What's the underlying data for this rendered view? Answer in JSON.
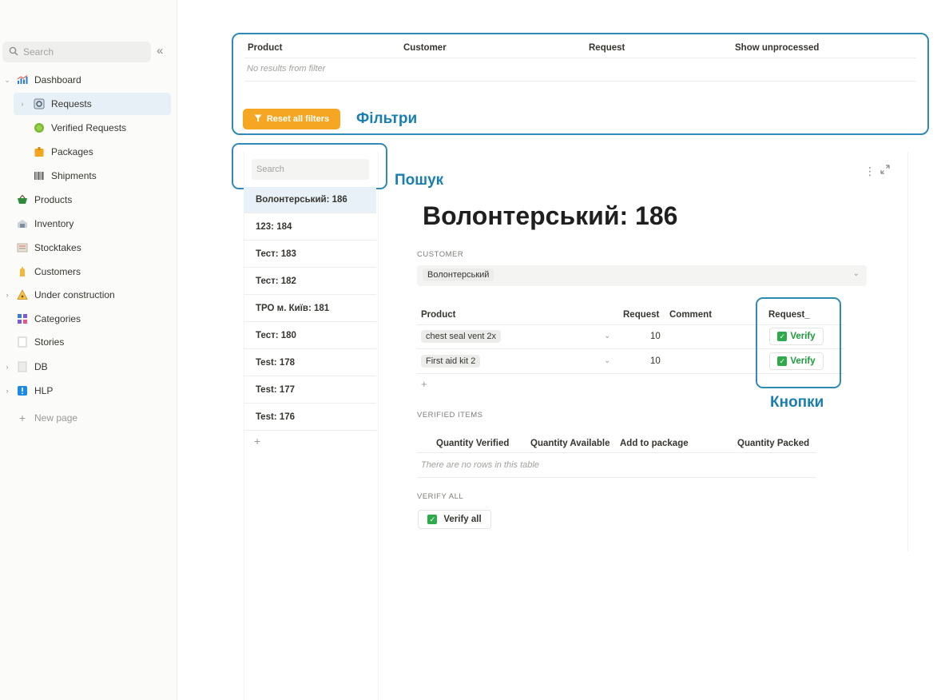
{
  "sidebar": {
    "search_placeholder": "Search",
    "collapse_glyph": "«",
    "items": [
      {
        "label": "Dashboard",
        "icon": "chart-icon"
      },
      {
        "label": "Requests",
        "icon": "gear-box-icon"
      },
      {
        "label": "Verified Requests",
        "icon": "verified-badge-icon"
      },
      {
        "label": "Packages",
        "icon": "package-icon"
      },
      {
        "label": "Shipments",
        "icon": "barcode-icon"
      },
      {
        "label": "Products",
        "icon": "basket-icon"
      },
      {
        "label": "Inventory",
        "icon": "warehouse-icon"
      },
      {
        "label": "Stocktakes",
        "icon": "clipboard-icon"
      },
      {
        "label": "Customers",
        "icon": "hand-icon"
      },
      {
        "label": "Under construction",
        "icon": "warning-icon"
      },
      {
        "label": "Categories",
        "icon": "shapes-icon"
      },
      {
        "label": "Stories",
        "icon": "page-icon"
      },
      {
        "label": "DB",
        "icon": "page-icon"
      },
      {
        "label": "HLP",
        "icon": "info-icon"
      }
    ],
    "new_page": "New page"
  },
  "filters": {
    "headers": [
      "Product",
      "Customer",
      "Request",
      "Show unprocessed"
    ],
    "empty_text": "No results from filter",
    "reset_label": "Reset all filters"
  },
  "annotations": {
    "filters": "Фільтри",
    "search": "Пошук",
    "buttons": "Кнопки"
  },
  "list": {
    "search_placeholder": "Search",
    "items": [
      "Волонтерський: 186",
      "123: 184",
      "Тест: 183",
      "Тест: 182",
      "ТРО м. Київ: 181",
      "Тест: 180",
      "Test: 178",
      "Test: 177",
      "Test: 176"
    ],
    "selected_index": 0
  },
  "detail": {
    "title": "Волонтерський: 186",
    "customer_label": "CUSTOMER",
    "customer_value": "Волонтерський",
    "products_table": {
      "headers": [
        "Product",
        "Request",
        "Comment",
        "Request_"
      ],
      "rows": [
        {
          "product": "chest seal vent 2x",
          "qty": "10",
          "action": "Verify"
        },
        {
          "product": "First aid kit 2",
          "qty": "10",
          "action": "Verify"
        }
      ]
    },
    "verified_label": "VERIFIED ITEMS",
    "verified_headers": [
      "Quantity Verified",
      "Quantity Available",
      "Add to package",
      "Quantity Packed"
    ],
    "verified_empty": "There are no rows in this table",
    "verify_all_label": "VERIFY ALL",
    "verify_all_button": "Verify all"
  },
  "colors": {
    "accent_annotation": "#2f8bb3",
    "reset_button": "#f5a623",
    "verify_green": "#2eaa4a"
  }
}
